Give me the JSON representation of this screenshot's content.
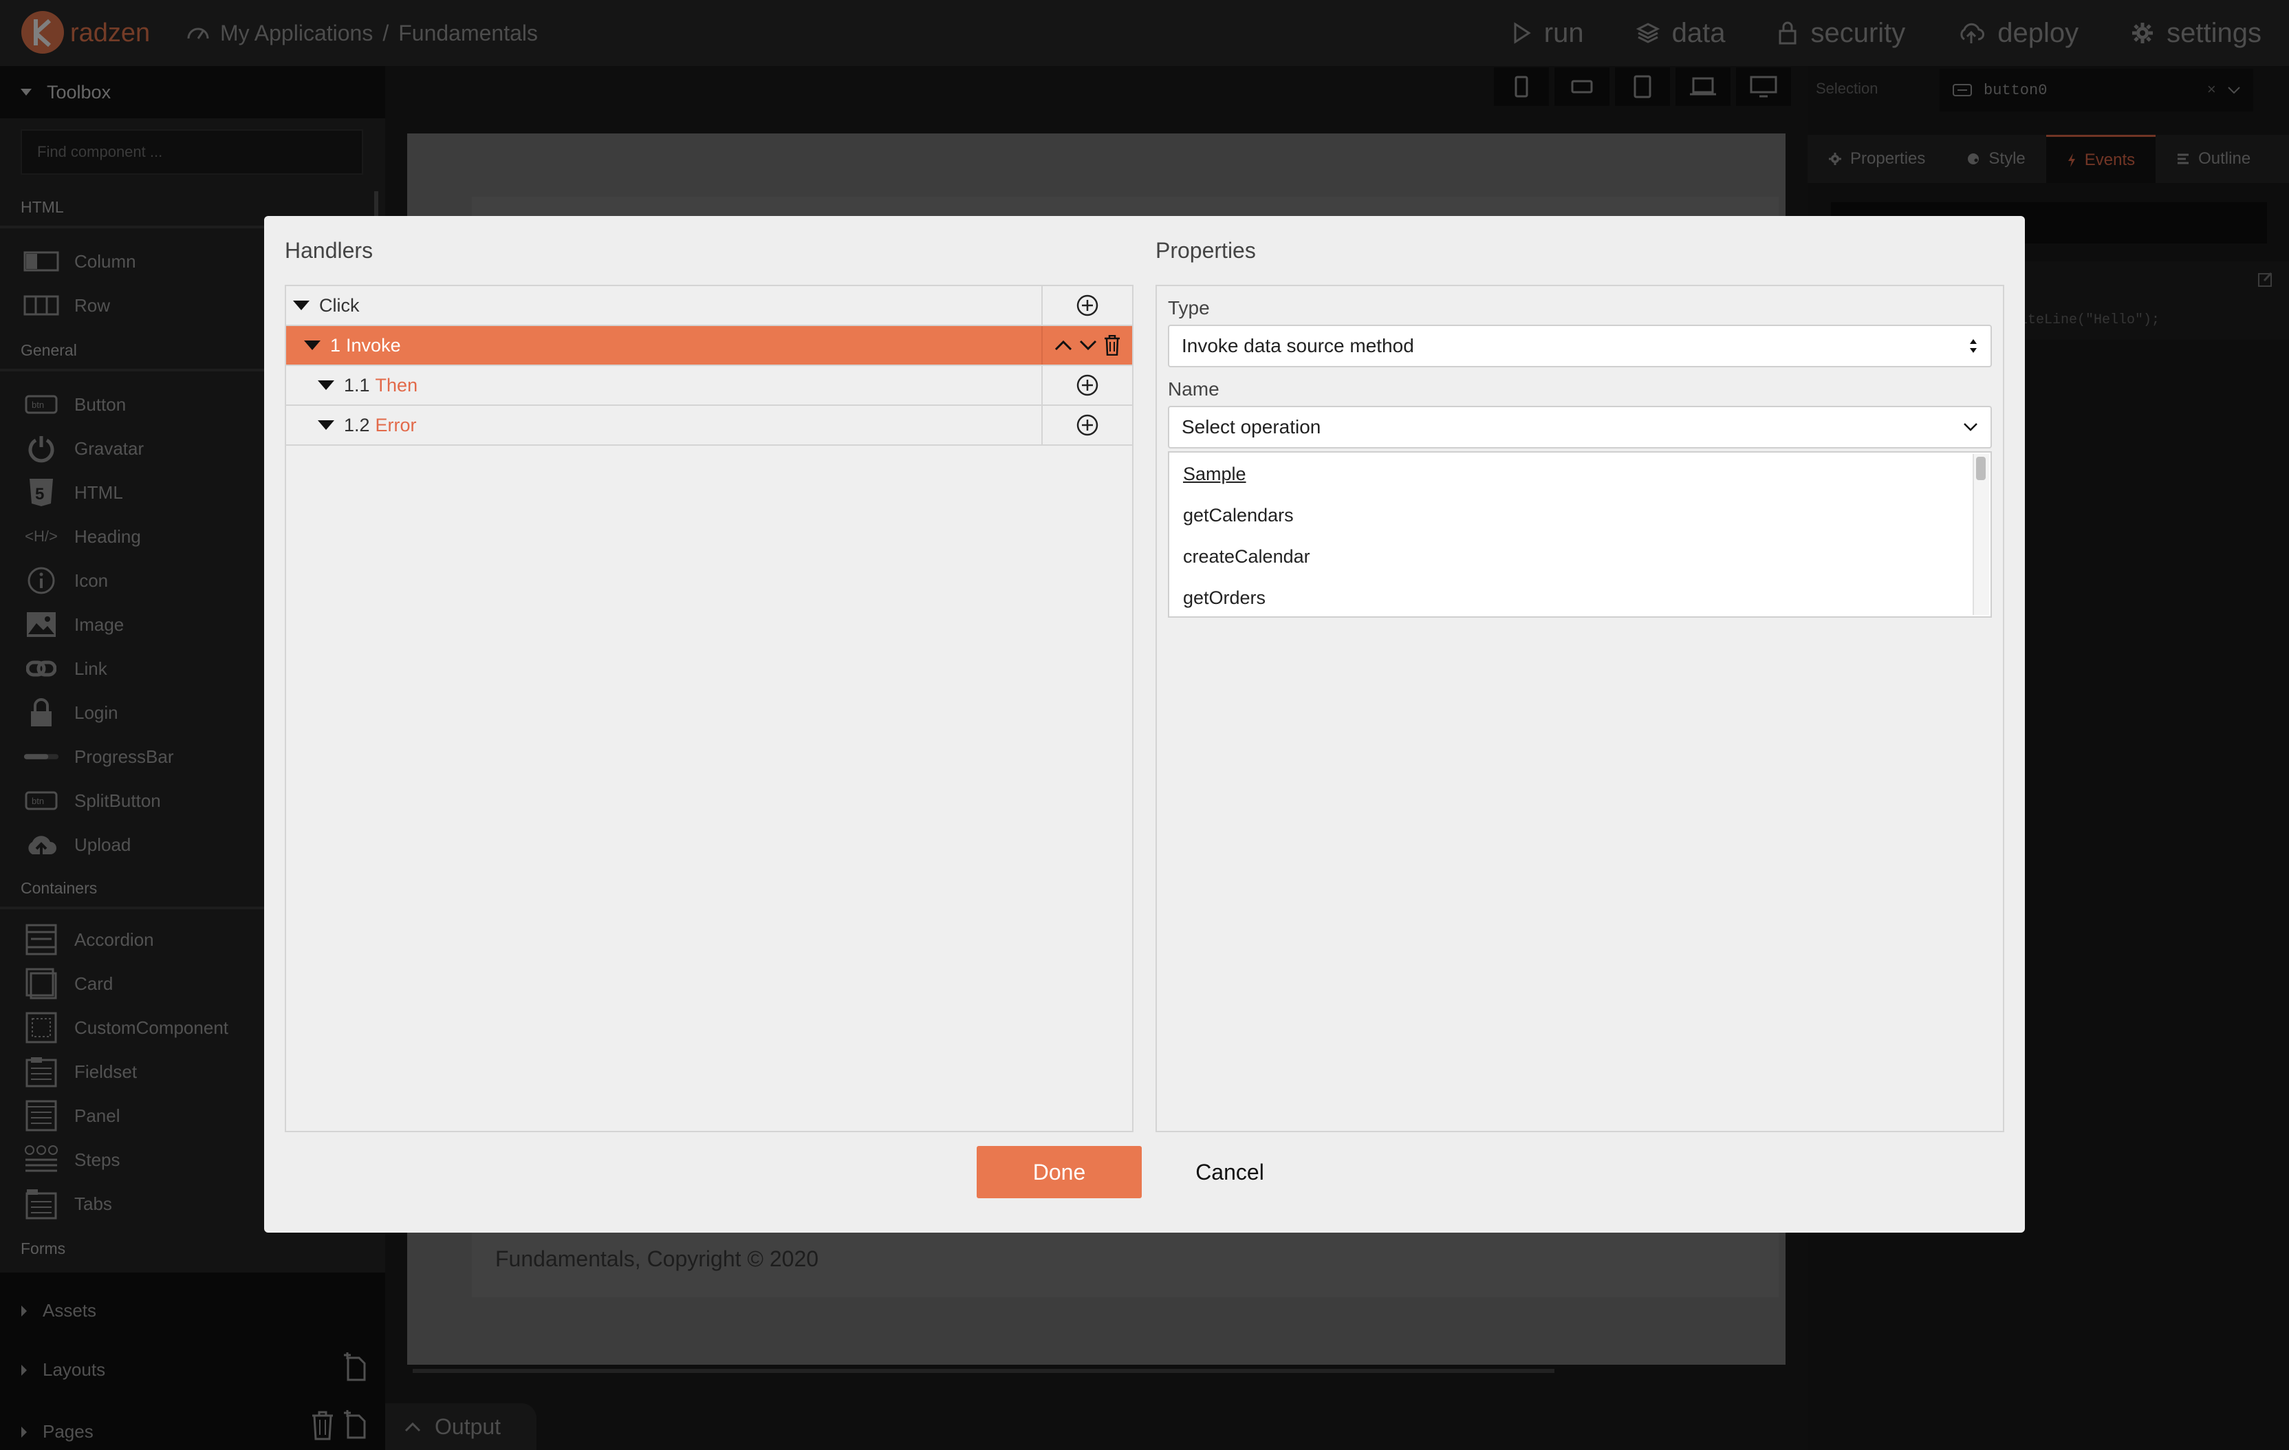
{
  "app": {
    "brand": "radzen",
    "accent": "#e9784f"
  },
  "breadcrumb": {
    "root": "My Applications",
    "separator": "/",
    "current": "Fundamentals"
  },
  "nav": [
    {
      "label": "run",
      "icon": "play-icon"
    },
    {
      "label": "data",
      "icon": "layers-icon"
    },
    {
      "label": "security",
      "icon": "lock-icon"
    },
    {
      "label": "deploy",
      "icon": "cloud-upload-icon"
    },
    {
      "label": "settings",
      "icon": "gear-icon"
    }
  ],
  "toolbox": {
    "title": "Toolbox",
    "search_placeholder": "Find component ...",
    "sections": {
      "html": "HTML",
      "general": "General",
      "containers": "Containers",
      "forms": "Forms"
    },
    "html_items": [
      "Column",
      "Row"
    ],
    "general_items": [
      "Button",
      "Gravatar",
      "HTML",
      "Heading",
      "Icon",
      "Image",
      "Link",
      "Login",
      "ProgressBar",
      "SplitButton",
      "Upload"
    ],
    "container_items": [
      "Accordion",
      "Card",
      "CustomComponent",
      "Fieldset",
      "Panel",
      "Steps",
      "Tabs"
    ],
    "bottom": [
      "Assets",
      "Layouts",
      "Pages"
    ]
  },
  "canvas": {
    "footer_text": "Fundamentals, Copyright © 2020"
  },
  "output": {
    "label": "Output"
  },
  "right_panel": {
    "selection_label": "Selection",
    "selection_value": "button0",
    "tabs": [
      "Properties",
      "Style",
      "Events",
      "Outline"
    ],
    "active_tab": "Events",
    "code_snippet": "iteLine(\"Hello\");"
  },
  "modal": {
    "handlers_title": "Handlers",
    "properties_title": "Properties",
    "handlers": {
      "event": "Click",
      "action_num": "1",
      "action_name": "Invoke",
      "then_num": "1.1",
      "then_label": "Then",
      "error_num": "1.2",
      "error_label": "Error"
    },
    "type_label": "Type",
    "type_value": "Invoke data source method",
    "name_label": "Name",
    "name_value": "Select operation",
    "operations": [
      "Sample",
      "getCalendars",
      "createCalendar",
      "getOrders"
    ],
    "done": "Done",
    "cancel": "Cancel"
  }
}
